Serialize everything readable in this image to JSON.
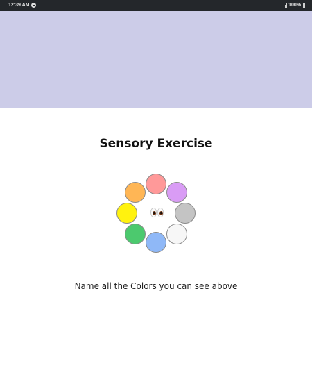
{
  "status_bar": {
    "time": "12:39 AM",
    "notification_icon": "circle-notification-icon",
    "signal_icon": "signal-icon",
    "battery_level": "100%",
    "battery_icon": "battery-icon"
  },
  "header": {
    "background_color": "#cccce8"
  },
  "exercise": {
    "title": "Sensory Exercise",
    "center_icon": "eyes-emoji-icon",
    "circle_colors": [
      {
        "name": "red",
        "hex": "#ff9999"
      },
      {
        "name": "purple",
        "hex": "#d99cf5"
      },
      {
        "name": "gray",
        "hex": "#c4c4c4"
      },
      {
        "name": "white",
        "hex": "#f7f7f7"
      },
      {
        "name": "blue",
        "hex": "#8fb8f7"
      },
      {
        "name": "green",
        "hex": "#4cc96e"
      },
      {
        "name": "yellow",
        "hex": "#fff20f"
      },
      {
        "name": "orange",
        "hex": "#ffb655"
      }
    ],
    "instruction": "Name all the Colors you can see above"
  }
}
